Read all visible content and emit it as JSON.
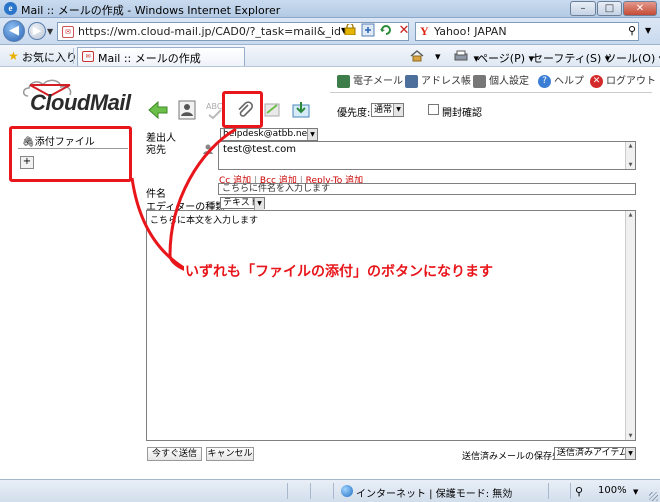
{
  "window": {
    "title": "Mail :: メールの作成 - Windows Internet Explorer",
    "min_glyph": "–",
    "max_glyph": "□",
    "close_glyph": "✕"
  },
  "navbar": {
    "url": "https://wm.cloud-mail.jp/CAD0/?_task=mail&_id=1516255583",
    "search_text": "Yahoo! JAPAN",
    "search_brand_glyph": "Y"
  },
  "favbar": {
    "favorites_label": "お気に入り",
    "tab_title": "Mail :: メールの作成",
    "commands": {
      "page": "ページ(P)",
      "safety": "セーフティ(S)",
      "tools": "ツール(O)"
    }
  },
  "app": {
    "brand": "CloudMail",
    "top_links": {
      "mail": "電子メール",
      "addressbook": "アドレス帳",
      "settings": "個人設定",
      "help": "ヘルプ",
      "logout": "ログアウト"
    },
    "compose": {
      "priority_label": "優先度:",
      "priority_value": "通常",
      "receipt_label": "開封確認",
      "attachments_title": "添付ファイル",
      "add_attachment_glyph": "+",
      "from_label": "差出人",
      "from_value": "helpdesk@atbb.ne.jp",
      "to_label": "宛先",
      "to_value": "test@test.com",
      "cc_link": "Cc 追加",
      "bcc_link": "Bcc 追加",
      "replyto_link": "Reply-To 追加",
      "link_separator": "|",
      "subject_label": "件名",
      "subject_value": "こちらに件名を入力します",
      "editor_label": "エディターの種類",
      "editor_value": "テキスト",
      "body_value": "こちらに本文を入力します",
      "send_button": "今すぐ送信",
      "cancel_button": "キャンセル",
      "sent_folder_label": "送信済みメールの保存先:",
      "sent_folder_value": "送信済みアイテム"
    }
  },
  "annotation": {
    "text": "いずれも「ファイルの添付」のボタンになります",
    "color": "#e8161b"
  },
  "statusbar": {
    "zone": "インターネット | 保護モード: 無効",
    "zoom": "100%"
  }
}
